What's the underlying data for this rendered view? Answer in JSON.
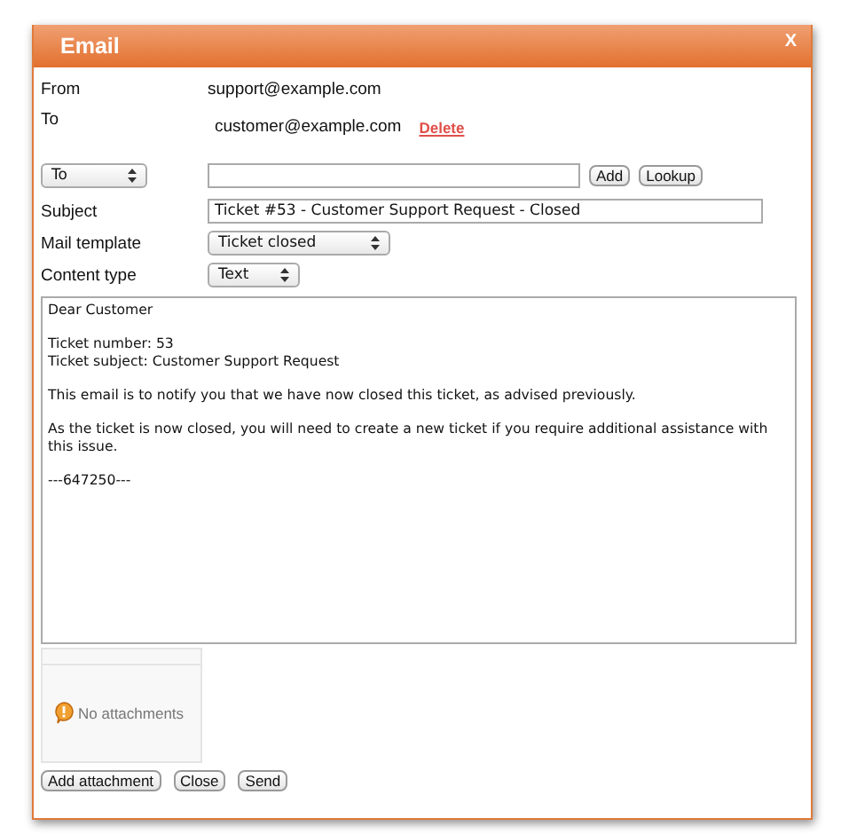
{
  "window": {
    "title": "Email",
    "close": "X"
  },
  "from": {
    "label": "From",
    "value": "support@example.com"
  },
  "to": {
    "label": "To",
    "recipients": [
      {
        "address": "customer@example.com",
        "action": "Delete"
      }
    ]
  },
  "recipient_type": {
    "value": "To"
  },
  "add_field": {
    "buttons": [
      "Add",
      "Lookup"
    ]
  },
  "subject": {
    "label": "Subject",
    "value": "Ticket #53 - Customer Support Request - Closed"
  },
  "mail_template": {
    "label": "Mail template",
    "value": "Ticket closed"
  },
  "content_type": {
    "label": "Content type",
    "value": "Text"
  },
  "body": {
    "paragraphs": [
      [
        "Dear Customer"
      ],
      [
        "Ticket number: 53",
        "Ticket subject: Customer Support Request"
      ],
      [
        "This email is to notify you that we have now closed this ticket, as advised previously."
      ],
      [
        "As the ticket is now closed, you will need to create a new ticket if you require additional assistance with this issue."
      ],
      [
        "---647250---"
      ]
    ]
  },
  "attachments": {
    "message": "No attachments"
  },
  "buttons": [
    "Add attachment",
    "Close",
    "Send"
  ]
}
